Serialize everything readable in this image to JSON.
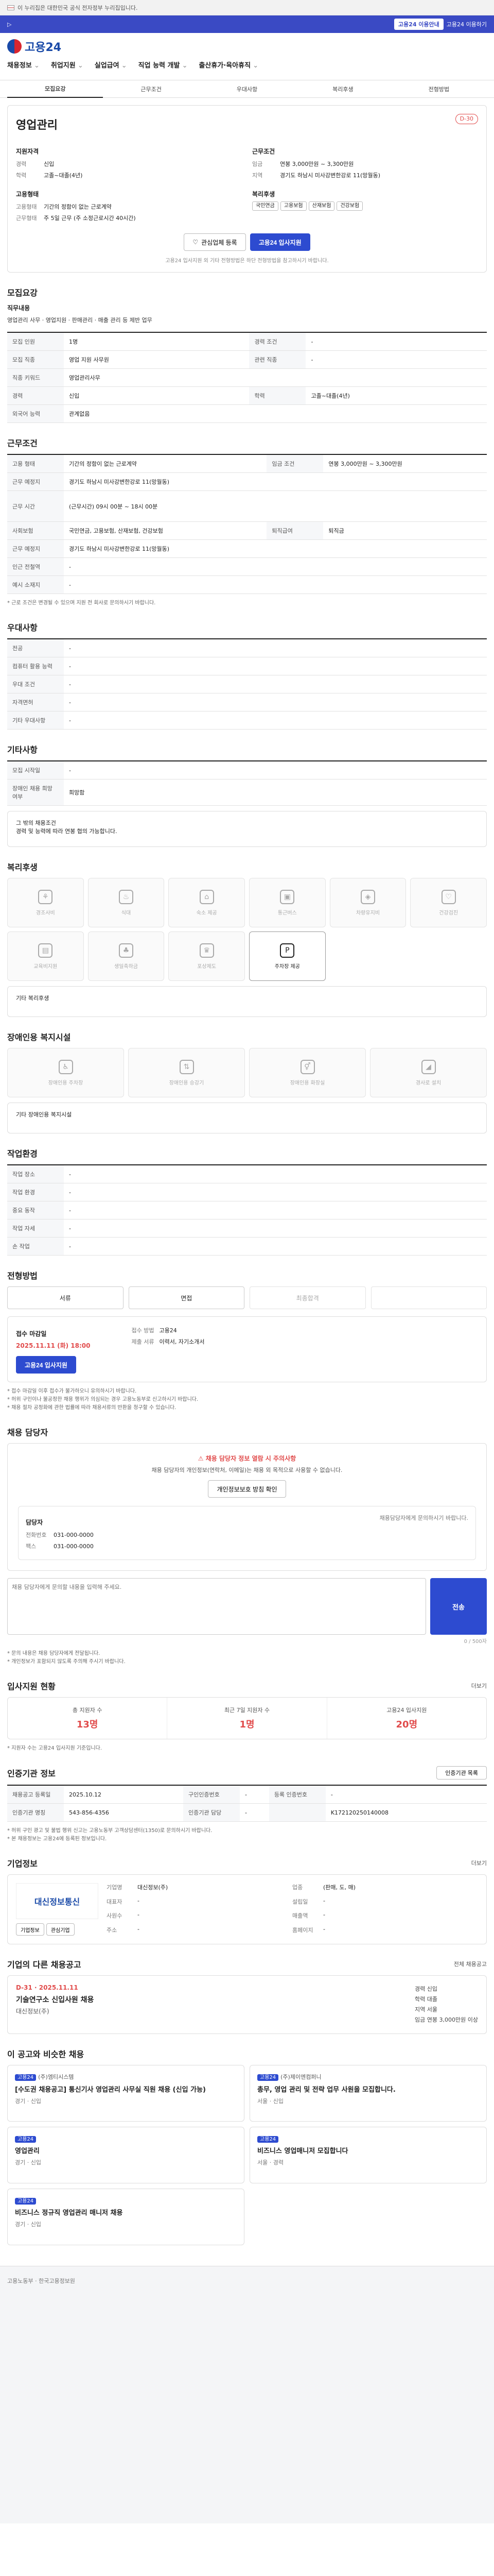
{
  "gov_banner": "이 누리집은 대한민국 공식 전자정부 누리집입니다.",
  "blue_strip": {
    "left": "▷",
    "right_pill": "고용24 이용안내",
    "right_text": "고용24 이용하기"
  },
  "header": {
    "logo": "고용24"
  },
  "gnb": [
    "채용정보",
    "취업지원",
    "실업급여",
    "직업 능력 개발",
    "출산휴가·육아휴직"
  ],
  "subnav": [
    "모집요강",
    "근무조건",
    "우대사항",
    "복리후생",
    "전형방법"
  ],
  "job": {
    "company": "",
    "title": "영업관리",
    "tag": "D-30",
    "left_title": "지원자격",
    "left_rows": [
      {
        "k": "경력",
        "v": "신입"
      },
      {
        "k": "학력",
        "v": "고졸~대졸(4년)"
      }
    ],
    "left_title2": "고용형태",
    "left_rows2": [
      {
        "k": "고용형태",
        "v": "기간의 정함이 없는 근로계약"
      },
      {
        "k": "근무형태",
        "v": "주 5일 근무 (주 소정근로시간 40시간)"
      }
    ],
    "right_title": "근무조건",
    "right_rows": [
      {
        "k": "임금",
        "v": "연봉 3,000만원 ~ 3,300만원"
      },
      {
        "k": "지역",
        "v": "경기도 하남시 미사강변한강로 11(망월동)"
      }
    ],
    "right_title2": "복리후생",
    "badges": [
      "국민연금",
      "고용보험",
      "산재보험",
      "건강보험"
    ],
    "btn_interest": "관심업체 등록",
    "btn_apply": "고용24 입사지원",
    "note": "고용24 입사지원 외 기타 전형방법은 하단 전형방법을 참고하시기 바랍니다."
  },
  "s_recruit": {
    "title": "모집요강",
    "desc_title": "직무내용",
    "desc": "영업관리 사무 · 영업지원 · 판매관리 · 매출 관리 등 제반 업무",
    "rows": [
      {
        "k": "모집 인원",
        "v": "1명",
        "k2": "경력 조건",
        "v2": "-"
      },
      {
        "k": "모집 직종",
        "v": "영업 지원 사무원",
        "k2": "관련 직종",
        "v2": "-"
      },
      {
        "k": "직종 키워드",
        "v": "영업관리사무",
        "k2": "",
        "v2": ""
      },
      {
        "k": "경력",
        "v": "신입",
        "k2": "학력",
        "v2": "고졸~대졸(4년)"
      },
      {
        "k": "외국어 능력",
        "v": "관계없음",
        "k2": "",
        "v2": ""
      }
    ]
  },
  "s_work": {
    "title": "근무조건",
    "rows": [
      {
        "k": "고용 형태",
        "v": "기간의 정함이 없는 근로계약",
        "k2": "임금 조건",
        "v2": "연봉 3,000만원 ~ 3,300만원"
      },
      {
        "k": "근무 예정지",
        "v": "경기도 하남시 미사강변한강로 11(망월동)",
        "k2": "",
        "v2": ""
      },
      {
        "k": "근무 시간",
        "v": "(근무시간) 09시 00분 ~ 18시 00분",
        "k2": "",
        "v2": ""
      },
      {
        "k": "사회보험",
        "v": "국민연금, 고용보험, 산재보험, 건강보험",
        "k2": "퇴직급여",
        "v2": "퇴직금"
      },
      {
        "k": "근무 예정지",
        "v": "경기도 하남시 미사강변한강로 11(망월동)",
        "k2": "",
        "v2": ""
      },
      {
        "k": "인근 전철역",
        "v": "-",
        "k2": "",
        "v2": ""
      },
      {
        "k": "예시 소재지",
        "v": "-",
        "k2": "",
        "v2": ""
      }
    ],
    "footnote": "* 근로 조건은 변경될 수 있으며 지원 전 회사로 문의하시기 바랍니다."
  },
  "s_pref": {
    "title": "우대사항",
    "rows": [
      {
        "k": "전공",
        "v": "-"
      },
      {
        "k": "컴퓨터 활용 능력",
        "v": "-"
      },
      {
        "k": "우대 조건",
        "v": "-"
      },
      {
        "k": "자격면허",
        "v": "-"
      },
      {
        "k": "기타 우대사항",
        "v": "-"
      }
    ]
  },
  "s_etc": {
    "title": "기타사항",
    "rows": [
      {
        "k": "모집 시작일",
        "v": "-"
      },
      {
        "k": "장애인 채용 희망 여부",
        "v": "희망함"
      }
    ],
    "note": "그 밖의 채용조건\n경력 및 능력에 따라 연봉 협의 가능합니다."
  },
  "s_welfare": {
    "title": "복리후생",
    "items": [
      {
        "icon": "gift-icon",
        "label": "경조사비",
        "on": false
      },
      {
        "icon": "meal-icon",
        "label": "식대",
        "on": false
      },
      {
        "icon": "house-icon",
        "label": "숙소 제공",
        "on": false
      },
      {
        "icon": "bus-icon",
        "label": "통근버스",
        "on": false
      },
      {
        "icon": "car-icon",
        "label": "차량유지비",
        "on": false
      },
      {
        "icon": "heart-icon",
        "label": "건강검진",
        "on": false
      },
      {
        "icon": "book-icon",
        "label": "교육비지원",
        "on": false
      },
      {
        "icon": "cake-icon",
        "label": "생일축하금",
        "on": false
      },
      {
        "icon": "trophy-icon",
        "label": "포상제도",
        "on": false
      },
      {
        "icon": "parking-icon",
        "label": "주차장 제공",
        "on": true
      }
    ],
    "note": "기타 복리후생"
  },
  "s_disab": {
    "title": "장애인용 복지시설",
    "items": [
      {
        "icon": "ramp-icon",
        "label": "장애인용 주차장"
      },
      {
        "icon": "elevator-icon",
        "label": "장애인용 승강기"
      },
      {
        "icon": "toilet-icon",
        "label": "장애인용 화장실"
      },
      {
        "icon": "wheelchair-icon",
        "label": "경사로 설치"
      }
    ],
    "note": "기타 장애인용 복지시설"
  },
  "s_env": {
    "title": "작업환경",
    "rows": [
      {
        "k": "작업 장소",
        "v": "-",
        "k2": "",
        "v2": ""
      },
      {
        "k": "작업 환경",
        "v": "-",
        "k2": "",
        "v2": ""
      },
      {
        "k": "중요 동작",
        "v": "-",
        "k2": "",
        "v2": ""
      },
      {
        "k": "작업 자세",
        "v": "-",
        "k2": "",
        "v2": ""
      },
      {
        "k": "손 작업",
        "v": "-",
        "k2": "",
        "v2": ""
      }
    ]
  },
  "s_select": {
    "title": "전형방법",
    "steps": [
      "서류",
      "면접",
      "최종합격",
      ""
    ],
    "deadline_k": "접수 마감일",
    "deadline_v": "2025.11.11 (화) 18:00",
    "apply_k": "접수 방법",
    "apply_v": "고용24",
    "doc_k": "제출 서류",
    "doc_v": "이력서, 자기소개서",
    "apply_btn": "고용24 입사지원",
    "bullets": [
      "* 접수 마감일 이후 접수가 불가하오니 유의하시기 바랍니다.",
      "* 허위 구인이나 불공정한 채용 행위가 의심되는 경우 고용노동부로 신고하시기 바랍니다.",
      "* 채용 절차 공정화에 관한 법률에 따라 채용서류의 반환을 청구할 수 있습니다."
    ]
  },
  "s_contact": {
    "title": "채용 담당자",
    "warn": "채용 담당자 정보 열람 시 주의사항",
    "desc": "채용 담당자의 개인정보(연락처, 이메일)는 채용 외 목적으로 사용할 수 없습니다.",
    "btn": "개인정보보호 방침 확인",
    "box_title": "담당자",
    "phone_k": "전화번호",
    "phone_v": "031-000-0000",
    "fax_k": "팩스",
    "fax_v": "031-000-0000",
    "email_k": "이메일",
    "email_v": "",
    "side_note": "채용담당자에게 문의하시기 바랍니다."
  },
  "s_inquiry": {
    "placeholder": "채용 담당자에게 문의할 내용을 입력해 주세요.",
    "send": "전송",
    "counter": "0 / 500자",
    "bullets": [
      "* 문의 내용은 채용 담당자에게 전달됩니다.",
      "* 개인정보가 포함되지 않도록 주의해 주시기 바랍니다."
    ]
  },
  "s_stats": {
    "title": "입사지원 현황",
    "more": "더보기",
    "items": [
      {
        "k": "총 지원자 수",
        "v": "13명"
      },
      {
        "k": "최근 7일 지원자 수",
        "v": "1명"
      },
      {
        "k": "고용24 입사지원",
        "v": "20명"
      }
    ],
    "note": "* 지원자 수는 고용24 입사지원 기준입니다."
  },
  "s_reg": {
    "title": "인증기관 정보",
    "btn": "인증기관 목록",
    "rows": [
      {
        "k": "채용공고 등록일",
        "v": "2025.10.12",
        "k2": "구인인증번호",
        "v2": "-",
        "k3": "등록 인증번호",
        "v3": "-"
      },
      {
        "k": "인증기관 명칭",
        "v": "543-856-4356",
        "k2": "인증기관 담당",
        "v2": "-",
        "k3": "",
        "v3": "K172120250140008"
      }
    ],
    "bullets": [
      "* 허위 구인 광고 및 불법 행위 신고는 고용노동부 고객상담센터(1350)로 문의하시기 바랍니다.",
      "* 본 채용정보는 고용24에 등록된 정보입니다."
    ]
  },
  "s_company": {
    "title": "기업정보",
    "more": "더보기",
    "logo": "대신정보통신",
    "rows": [
      {
        "k": "기업명",
        "v": "대신정보(주)",
        "k2": "업종",
        "v2": "(판매, 도, 매)"
      },
      {
        "k": "대표자",
        "v": "-",
        "k2": "설립일",
        "v2": "-"
      },
      {
        "k": "사원수",
        "v": "-",
        "k2": "매출액",
        "v2": "-"
      },
      {
        "k": "주소",
        "v": "-",
        "k2": "홈페이지",
        "v2": "-"
      }
    ],
    "btns": [
      "기업정보",
      "관심기업"
    ]
  },
  "s_other": {
    "title": "기업의 다른 채용공고",
    "more": "전체 채용공고",
    "card_corp": "대신정보(주)",
    "card_title": "기술연구소 신입사원 채용",
    "card_meta": "D-31 · 2025.11.11",
    "right_rows": [
      "경력 신입",
      "학력 대졸",
      "지역 서울",
      "임금 연봉 3,000만원 이상"
    ]
  },
  "s_recommend": {
    "title": "이 공고와 비슷한 채용",
    "cards": [
      {
        "chip": "고용24",
        "corp": "(주)엠티시스템",
        "title": "[수도권 채용공고] 통신기사 영업관리 사무실 직원 채용 (신입 가능)",
        "meta": "경기 · 신입"
      },
      {
        "chip": "고용24",
        "corp": "(주)제이엔컴퍼니",
        "title": "총무, 영업 관리 및 전략 업무 사원을 모집합니다.",
        "meta": "서울 · 신입"
      },
      {
        "chip": "고용24",
        "corp": "",
        "title": "영업관리",
        "meta": "경기 · 신입"
      },
      {
        "chip": "고용24",
        "corp": "",
        "title": "비즈니스 영업매니저 모집합니다",
        "meta": "서울 · 경력"
      },
      {
        "chip": "고용24",
        "corp": "",
        "title": "비즈니스 정규직 영업관리 매니저 채용",
        "meta": "경기 · 신입"
      }
    ]
  },
  "footer": {
    "text": "고용노동부 · 한국고용정보원"
  }
}
